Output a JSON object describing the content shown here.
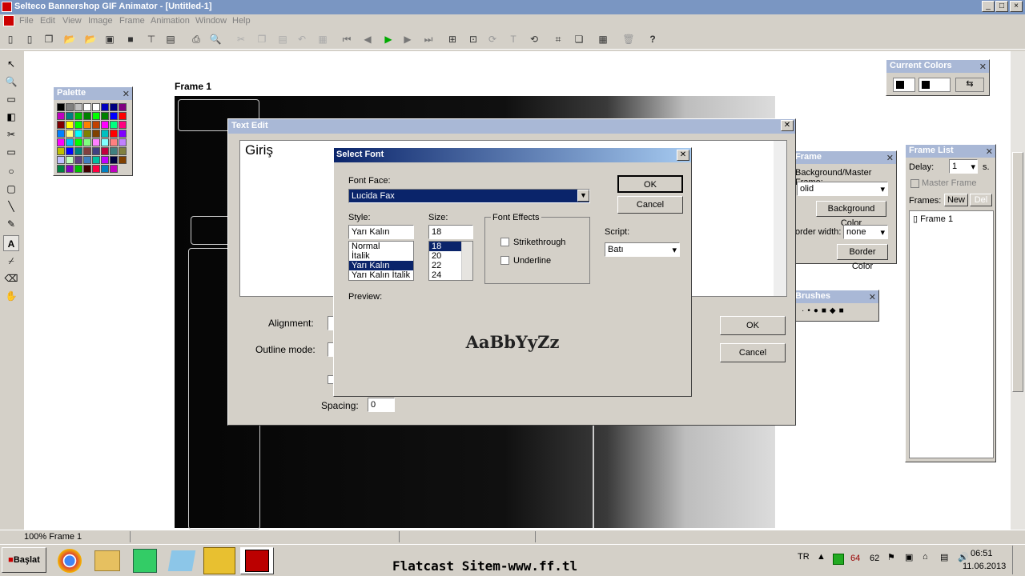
{
  "window": {
    "title": "Selteco Bannershop GIF Animator - [Untitled-1]",
    "min": "_",
    "max": "□",
    "close": "×"
  },
  "menu": [
    "File",
    "Edit",
    "View",
    "Image",
    "Frame",
    "Animation",
    "Window",
    "Help"
  ],
  "canvas": {
    "frame_label": "Frame 1"
  },
  "palette": {
    "title": "Palette",
    "colors": [
      "#000000",
      "#808080",
      "#c0c0c0",
      "#ffffff",
      "#ffffff",
      "#0000c0",
      "#000080",
      "#800080",
      "#c000c0",
      "#008080",
      "#00c000",
      "#008000",
      "#00ff00",
      "#008000",
      "#0000ff",
      "#ff0000",
      "#800000",
      "#ffff00",
      "#00ff00",
      "#ff8000",
      "#c04000",
      "#ff00ff",
      "#00ff80",
      "#ff0080",
      "#0080ff",
      "#ffff80",
      "#00ffff",
      "#808000",
      "#804000",
      "#00c0c0",
      "#ff0000",
      "#8000ff",
      "#ff00ff",
      "#00c0ff",
      "#00ff00",
      "#80ff80",
      "#ff80ff",
      "#80ffff",
      "#ff8080",
      "#c080ff",
      "#c0c000",
      "#0000ff",
      "#008080",
      "#804040",
      "#404080",
      "#c00040",
      "#408080",
      "#808040",
      "#c0c0ff",
      "#c0ffc0",
      "#604080",
      "#4080c0",
      "#00c0a0",
      "#c000ff",
      "#000040",
      "#804000",
      "#008040",
      "#8000c0",
      "#00c000",
      "#400000",
      "#ff0040",
      "#0080c0",
      "#c000c0"
    ]
  },
  "current_colors": {
    "title": "Current Colors"
  },
  "frame_list": {
    "title": "Frame List",
    "delay_label": "Delay:",
    "delay_value": "1",
    "delay_unit": "s.",
    "master_frame": "Master Frame",
    "frames_label": "Frames:",
    "new_btn": "New",
    "del_btn": "Del",
    "item": "Frame 1"
  },
  "frame_panel": {
    "title": "Frame",
    "bg_label": "Background/Master Frame:",
    "bg_value": "olid",
    "bg_color_btn": "Background Color",
    "border_label": "order width:",
    "border_value": "none",
    "border_color_btn": "Border Color"
  },
  "brushes": {
    "title": "Brushes"
  },
  "text_edit": {
    "title": "Text Edit",
    "text": "Giriş",
    "alignment": "Alignment:",
    "outline": "Outline mode:",
    "spacing_label": "Spacing:",
    "spacing_value": "0",
    "ok": "OK",
    "cancel": "Cancel"
  },
  "select_font": {
    "title": "Select Font",
    "font_face_label": "Font Face:",
    "font_face": "Lucida Fax",
    "style_label": "Style:",
    "style_value": "Yarı Kalın",
    "styles": [
      "Normal",
      "İtalik",
      "Yarı Kalın",
      "Yarı Kalın İtalik"
    ],
    "size_label": "Size:",
    "size_value": "18",
    "sizes": [
      "18",
      "20",
      "22",
      "24"
    ],
    "effects_label": "Font Effects",
    "strike": "Strikethrough",
    "underline": "Underline",
    "script_label": "Script:",
    "script_value": "Batı",
    "preview_label": "Preview:",
    "preview_text": "AaBbYyZz",
    "ok": "OK",
    "cancel": "Cancel"
  },
  "status": {
    "zoom": "100% Frame 1"
  },
  "taskbar": {
    "start": "Başlat",
    "banner": "Flatcast Sitem-www.ff.tl",
    "lang": "TR",
    "n1": "64",
    "n2": "62",
    "time": "06:51",
    "date": "11.06.2013"
  }
}
